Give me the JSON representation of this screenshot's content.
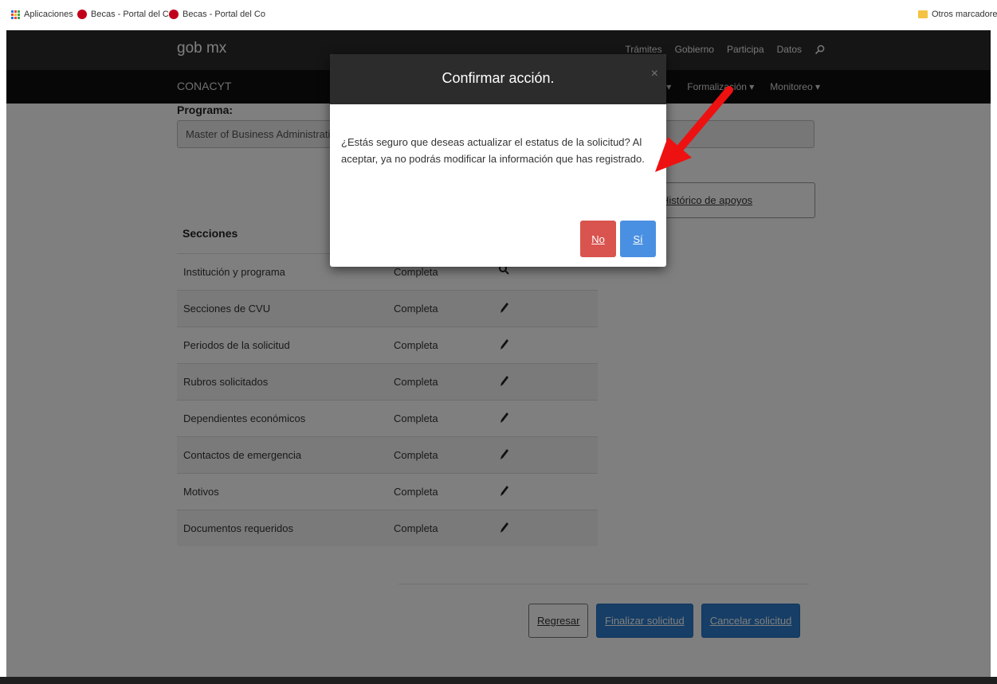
{
  "bookmarks": {
    "apps_label": "Aplicaciones",
    "items": [
      "Becas - Portal del Co",
      "Becas - Portal del Co"
    ],
    "other_label": "Otros marcadores"
  },
  "header": {
    "logo": "gob mx",
    "nav": [
      "Trámites",
      "Gobierno",
      "Participa",
      "Datos"
    ],
    "search_icon": "search-icon"
  },
  "subheader": {
    "logo": "CONACYT",
    "nav": [
      "... ▾",
      "Formalización ▾",
      "Monitoreo ▾"
    ]
  },
  "form": {
    "program_label": "Programa:",
    "program_value": "Master of Business Administrati",
    "history_button": "Histórico de apoyos"
  },
  "sections": {
    "title": "Secciones",
    "rows": [
      {
        "name": "Institución y programa",
        "status": "Completa",
        "action": "search-icon"
      },
      {
        "name": "Secciones de CVU",
        "status": "Completa",
        "action": "pencil-icon"
      },
      {
        "name": "Periodos de la solicitud",
        "status": "Completa",
        "action": "pencil-icon"
      },
      {
        "name": "Rubros solicitados",
        "status": "Completa",
        "action": "pencil-icon"
      },
      {
        "name": "Dependientes económicos",
        "status": "Completa",
        "action": "pencil-icon"
      },
      {
        "name": "Contactos de emergencia",
        "status": "Completa",
        "action": "pencil-icon"
      },
      {
        "name": "Motivos",
        "status": "Completa",
        "action": "pencil-icon"
      },
      {
        "name": "Documentos requeridos",
        "status": "Completa",
        "action": "pencil-icon"
      }
    ]
  },
  "actions": {
    "back": "Regresar",
    "finish": "Finalizar solicitud",
    "cancel": "Cancelar solicitud"
  },
  "modal": {
    "title": "Confirmar acción.",
    "close": "×",
    "message": "¿Estás seguro que deseas actualizar el estatus de la solicitud? Al aceptar, ya no podrás modificar la información que has registrado.",
    "no_label": "No",
    "yes_label": "Sí"
  },
  "colors": {
    "header_bg": "#2b2b2b",
    "subheader_bg": "#0e0e0e",
    "primary": "#2d7dcc",
    "danger": "#d9534f",
    "annotation_arrow": "#ee1111"
  }
}
